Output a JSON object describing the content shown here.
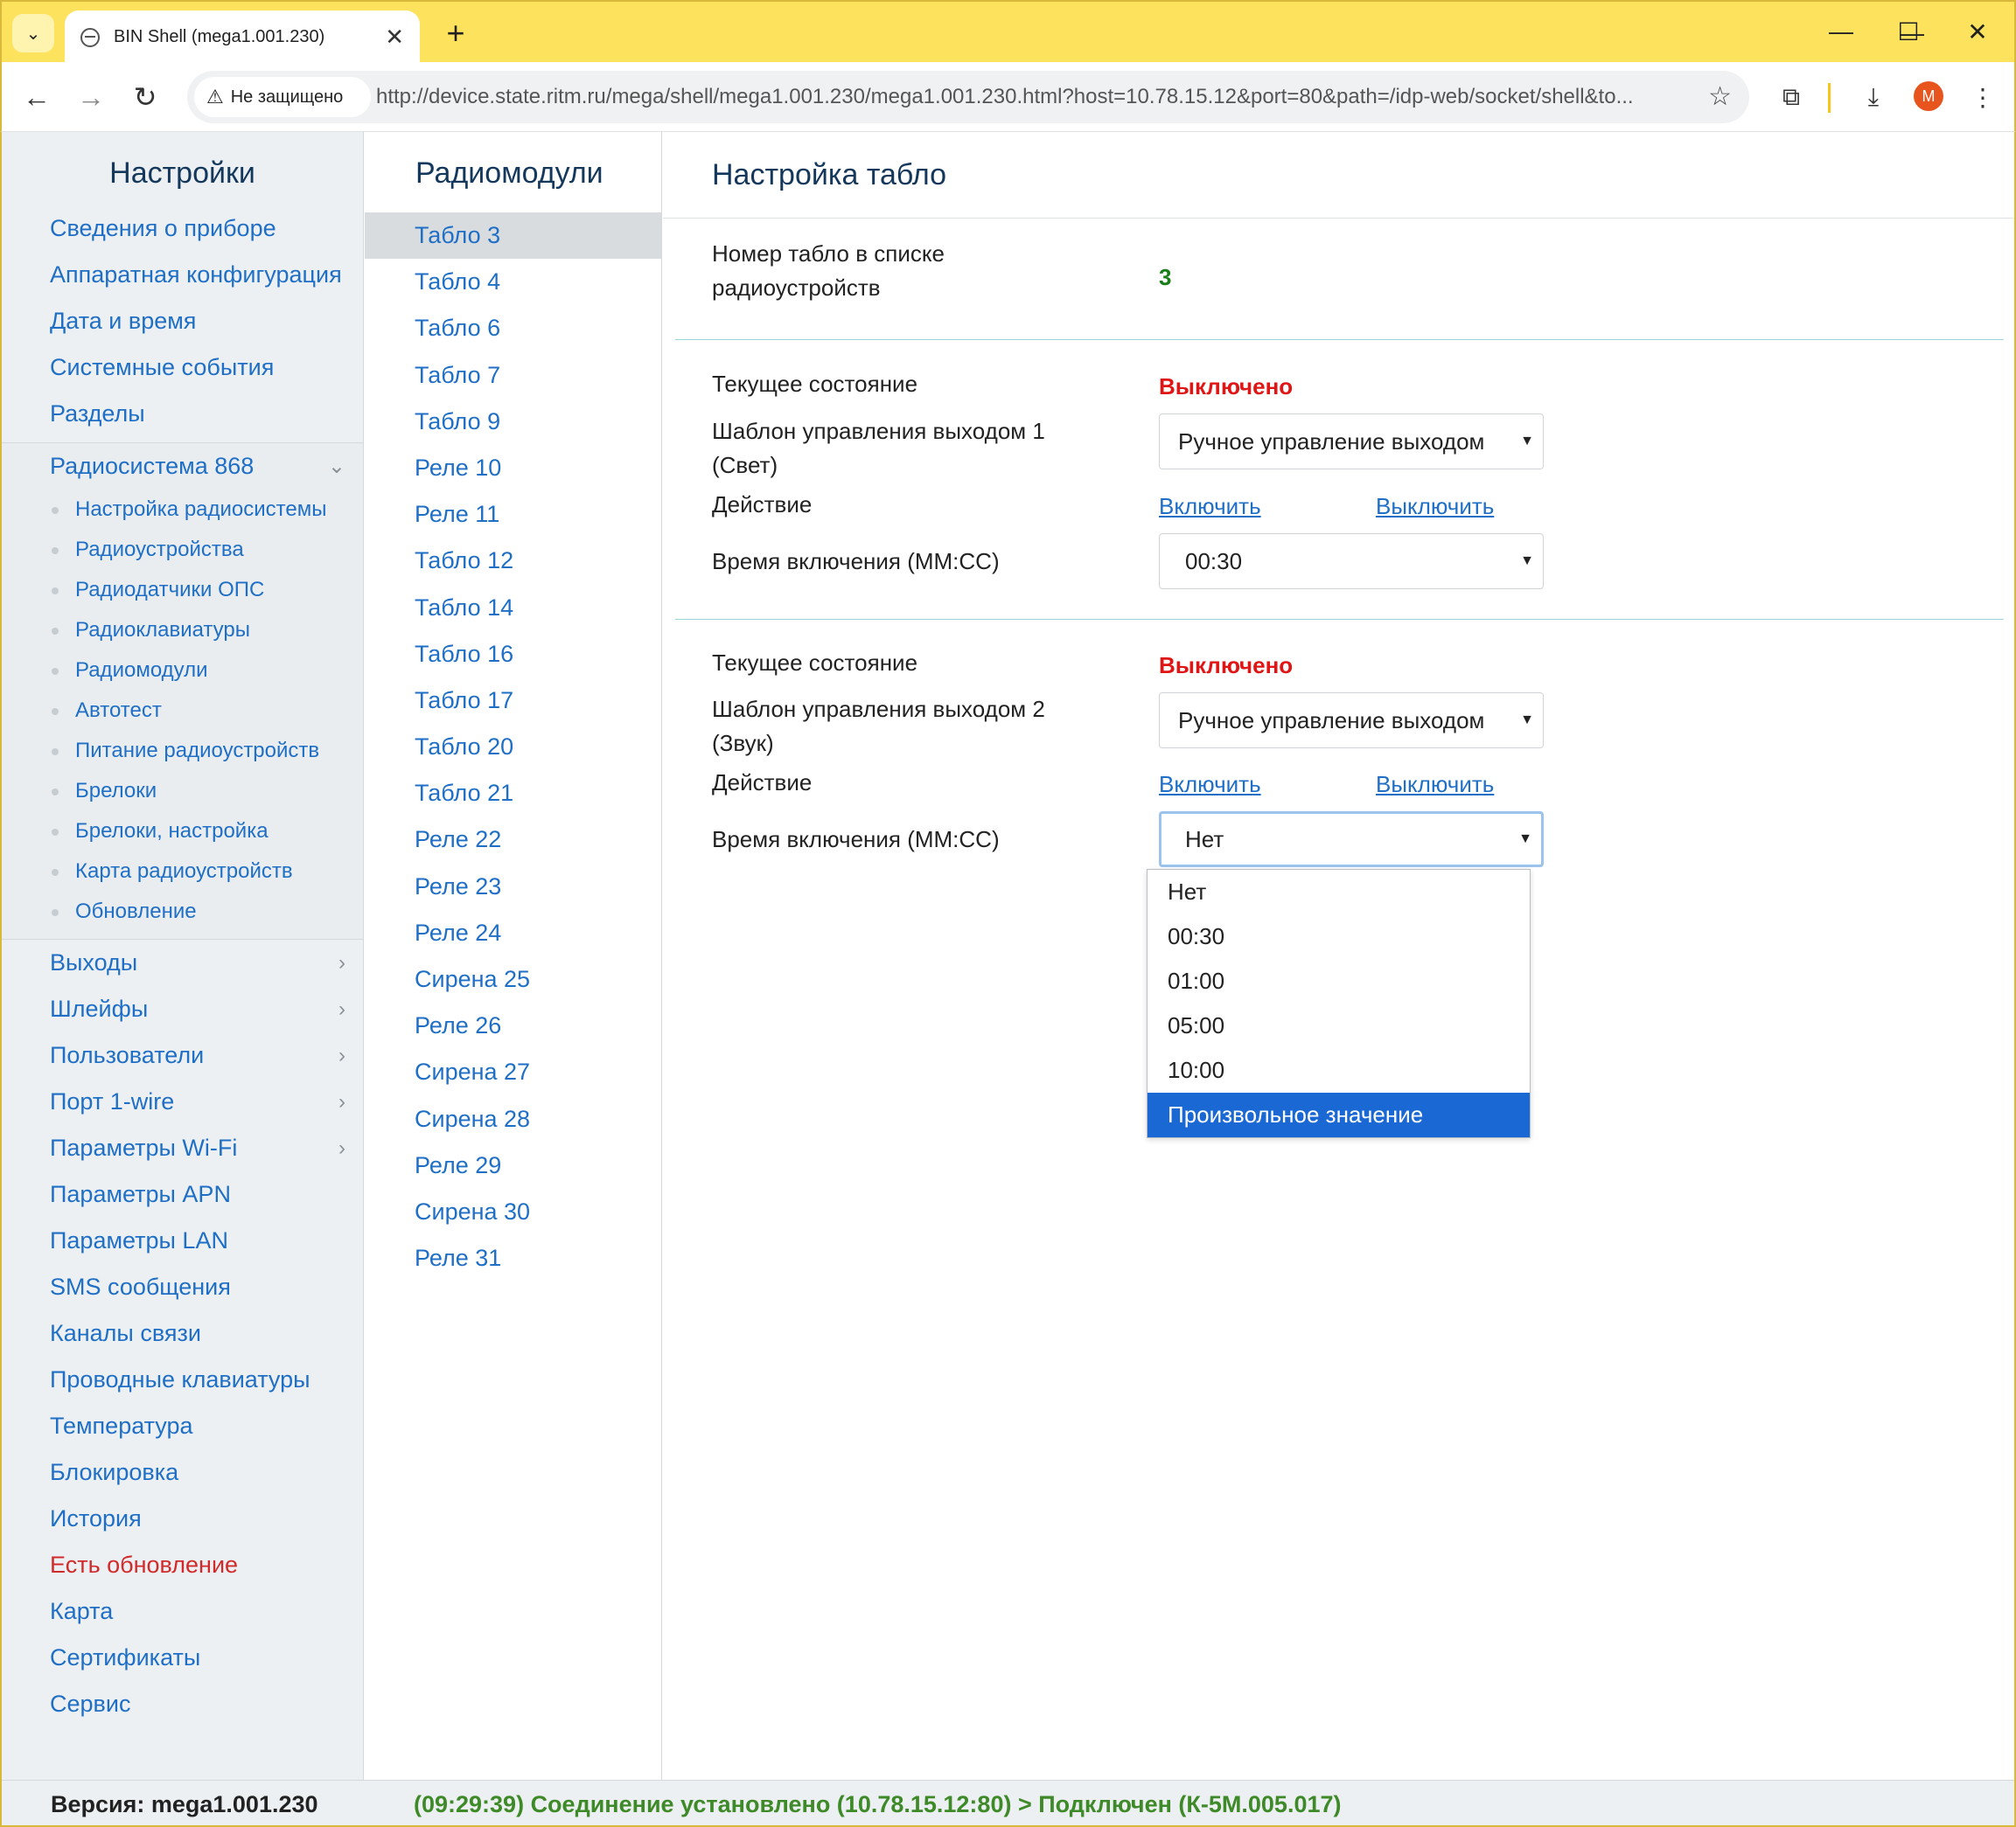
{
  "browser": {
    "tab_title": "BIN Shell (mega1.001.230)",
    "security_label": "Не защищено",
    "url": "http://device.state.ritm.ru/mega/shell/mega1.001.230/mega1.001.230.html?host=10.78.15.12&port=80&path=/idp-web/socket/shell&to...",
    "profile_initial": "M",
    "accent_color": "#fde35d"
  },
  "settings_nav": {
    "title": "Настройки",
    "top_items": [
      "Сведения о приборе",
      "Аппаратная конфигурация",
      "Дата и время",
      "Системные события",
      "Разделы"
    ],
    "expanded": {
      "label": "Радиосистема 868",
      "children": [
        "Настройка радиосистемы",
        "Радиоустройства",
        "Радиодатчики ОПС",
        "Радиоклавиатуры",
        "Радиомодули",
        "Автотест",
        "Питание радиоустройств",
        "Брелоки",
        "Брелоки, настройка",
        "Карта радиоустройств",
        "Обновление"
      ]
    },
    "collapsible_items": [
      "Выходы",
      "Шлейфы",
      "Пользователи",
      "Порт 1-wire",
      "Параметры Wi-Fi"
    ],
    "bottom_items": [
      "Параметры APN",
      "Параметры LAN",
      "SMS сообщения",
      "Каналы связи",
      "Проводные клавиатуры",
      "Температура",
      "Блокировка",
      "История"
    ],
    "update_item": "Есть обновление",
    "tail_items": [
      "Карта",
      "Сертификаты",
      "Сервис"
    ]
  },
  "radiomodules": {
    "title": "Радиомодули",
    "selected": "Табло 3",
    "items": [
      "Табло 3",
      "Табло 4",
      "Табло 6",
      "Табло 7",
      "Табло 9",
      "Реле 10",
      "Реле 11",
      "Табло 12",
      "Табло 14",
      "Табло 16",
      "Табло 17",
      "Табло 20",
      "Табло 21",
      "Реле 22",
      "Реле 23",
      "Реле 24",
      "Сирена 25",
      "Реле 26",
      "Сирена 27",
      "Сирена 28",
      "Реле 29",
      "Сирена 30",
      "Реле 31"
    ]
  },
  "panel": {
    "title": "Настройка табло",
    "number_label_line1": "Номер табло в списке",
    "number_label_line2": "радиоустройств",
    "number_value": "3",
    "output1": {
      "state_label": "Текущее состояние",
      "state_value": "Выключено",
      "template_label_line1": "Шаблон управления выходом 1",
      "template_label_line2": "(Свет)",
      "template_value": "Ручное управление выходом",
      "action_label": "Действие",
      "action_on": "Включить",
      "action_off": "Выключить",
      "time_label": "Время включения (ММ:СС)",
      "time_value": "00:30"
    },
    "output2": {
      "state_label": "Текущее состояние",
      "state_value": "Выключено",
      "template_label_line1": "Шаблон управления выходом 2",
      "template_label_line2": "(Звук)",
      "template_value": "Ручное управление выходом",
      "action_label": "Действие",
      "action_on": "Включить",
      "action_off": "Выключить",
      "time_label": "Время включения (ММ:СС)",
      "time_value": "Нет"
    },
    "time_dropdown": {
      "options": [
        "Нет",
        "00:30",
        "01:00",
        "05:00",
        "10:00",
        "Произвольное значение"
      ],
      "highlighted": "Произвольное значение"
    }
  },
  "status": {
    "version": "Версия: mega1.001.230",
    "connection": "(09:29:39) Соединение установлено (10.78.15.12:80) > Подключен (К-5М.005.017)"
  }
}
